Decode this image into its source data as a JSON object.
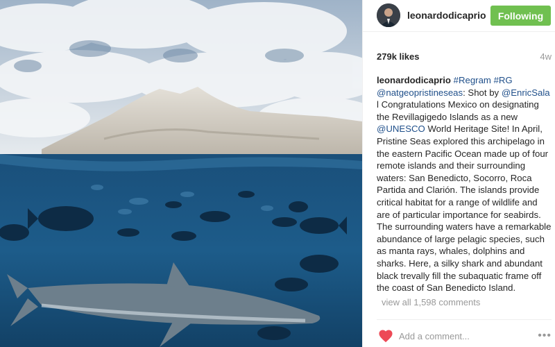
{
  "photo": {
    "description_icon": "photo-underwater-shark"
  },
  "header": {
    "username": "leonardodicaprio",
    "follow_label": "Following",
    "follow_color": "#70c050"
  },
  "stats": {
    "likes": "279k likes",
    "age": "4w"
  },
  "caption": {
    "user": "leonardodicaprio",
    "tag1": "#Regram",
    "tag2": "#RG",
    "mention1": "@natgeopristineseas",
    "text1": ": Shot by ",
    "mention2": "@EnricSala",
    "text2": "l Congratulations Mexico on designating the Revillagigedo Islands as a new ",
    "mention3": "@UNESCO",
    "text3": " World Heritage Site! In April, Pristine Seas explored this archipelago in the eastern Pacific Ocean made up of four remote islands and their surrounding waters: San Benedicto, Socorro, Roca Partida and Clarión. The islands provide critical habitat for a range of wildlife and are of particular importance for seabirds. The surrounding waters have a remarkable abundance of large pelagic species, such as manta rays, whales, dolphins and sharks. Here, a silky shark and abundant black trevally fill the subaquatic frame off the coast of San Benedicto Island."
  },
  "comments": {
    "view_all": "view all 1,598 comments"
  },
  "footer": {
    "placeholder": "Add a comment...",
    "more": "•••",
    "heart_color": "#ed4956"
  }
}
